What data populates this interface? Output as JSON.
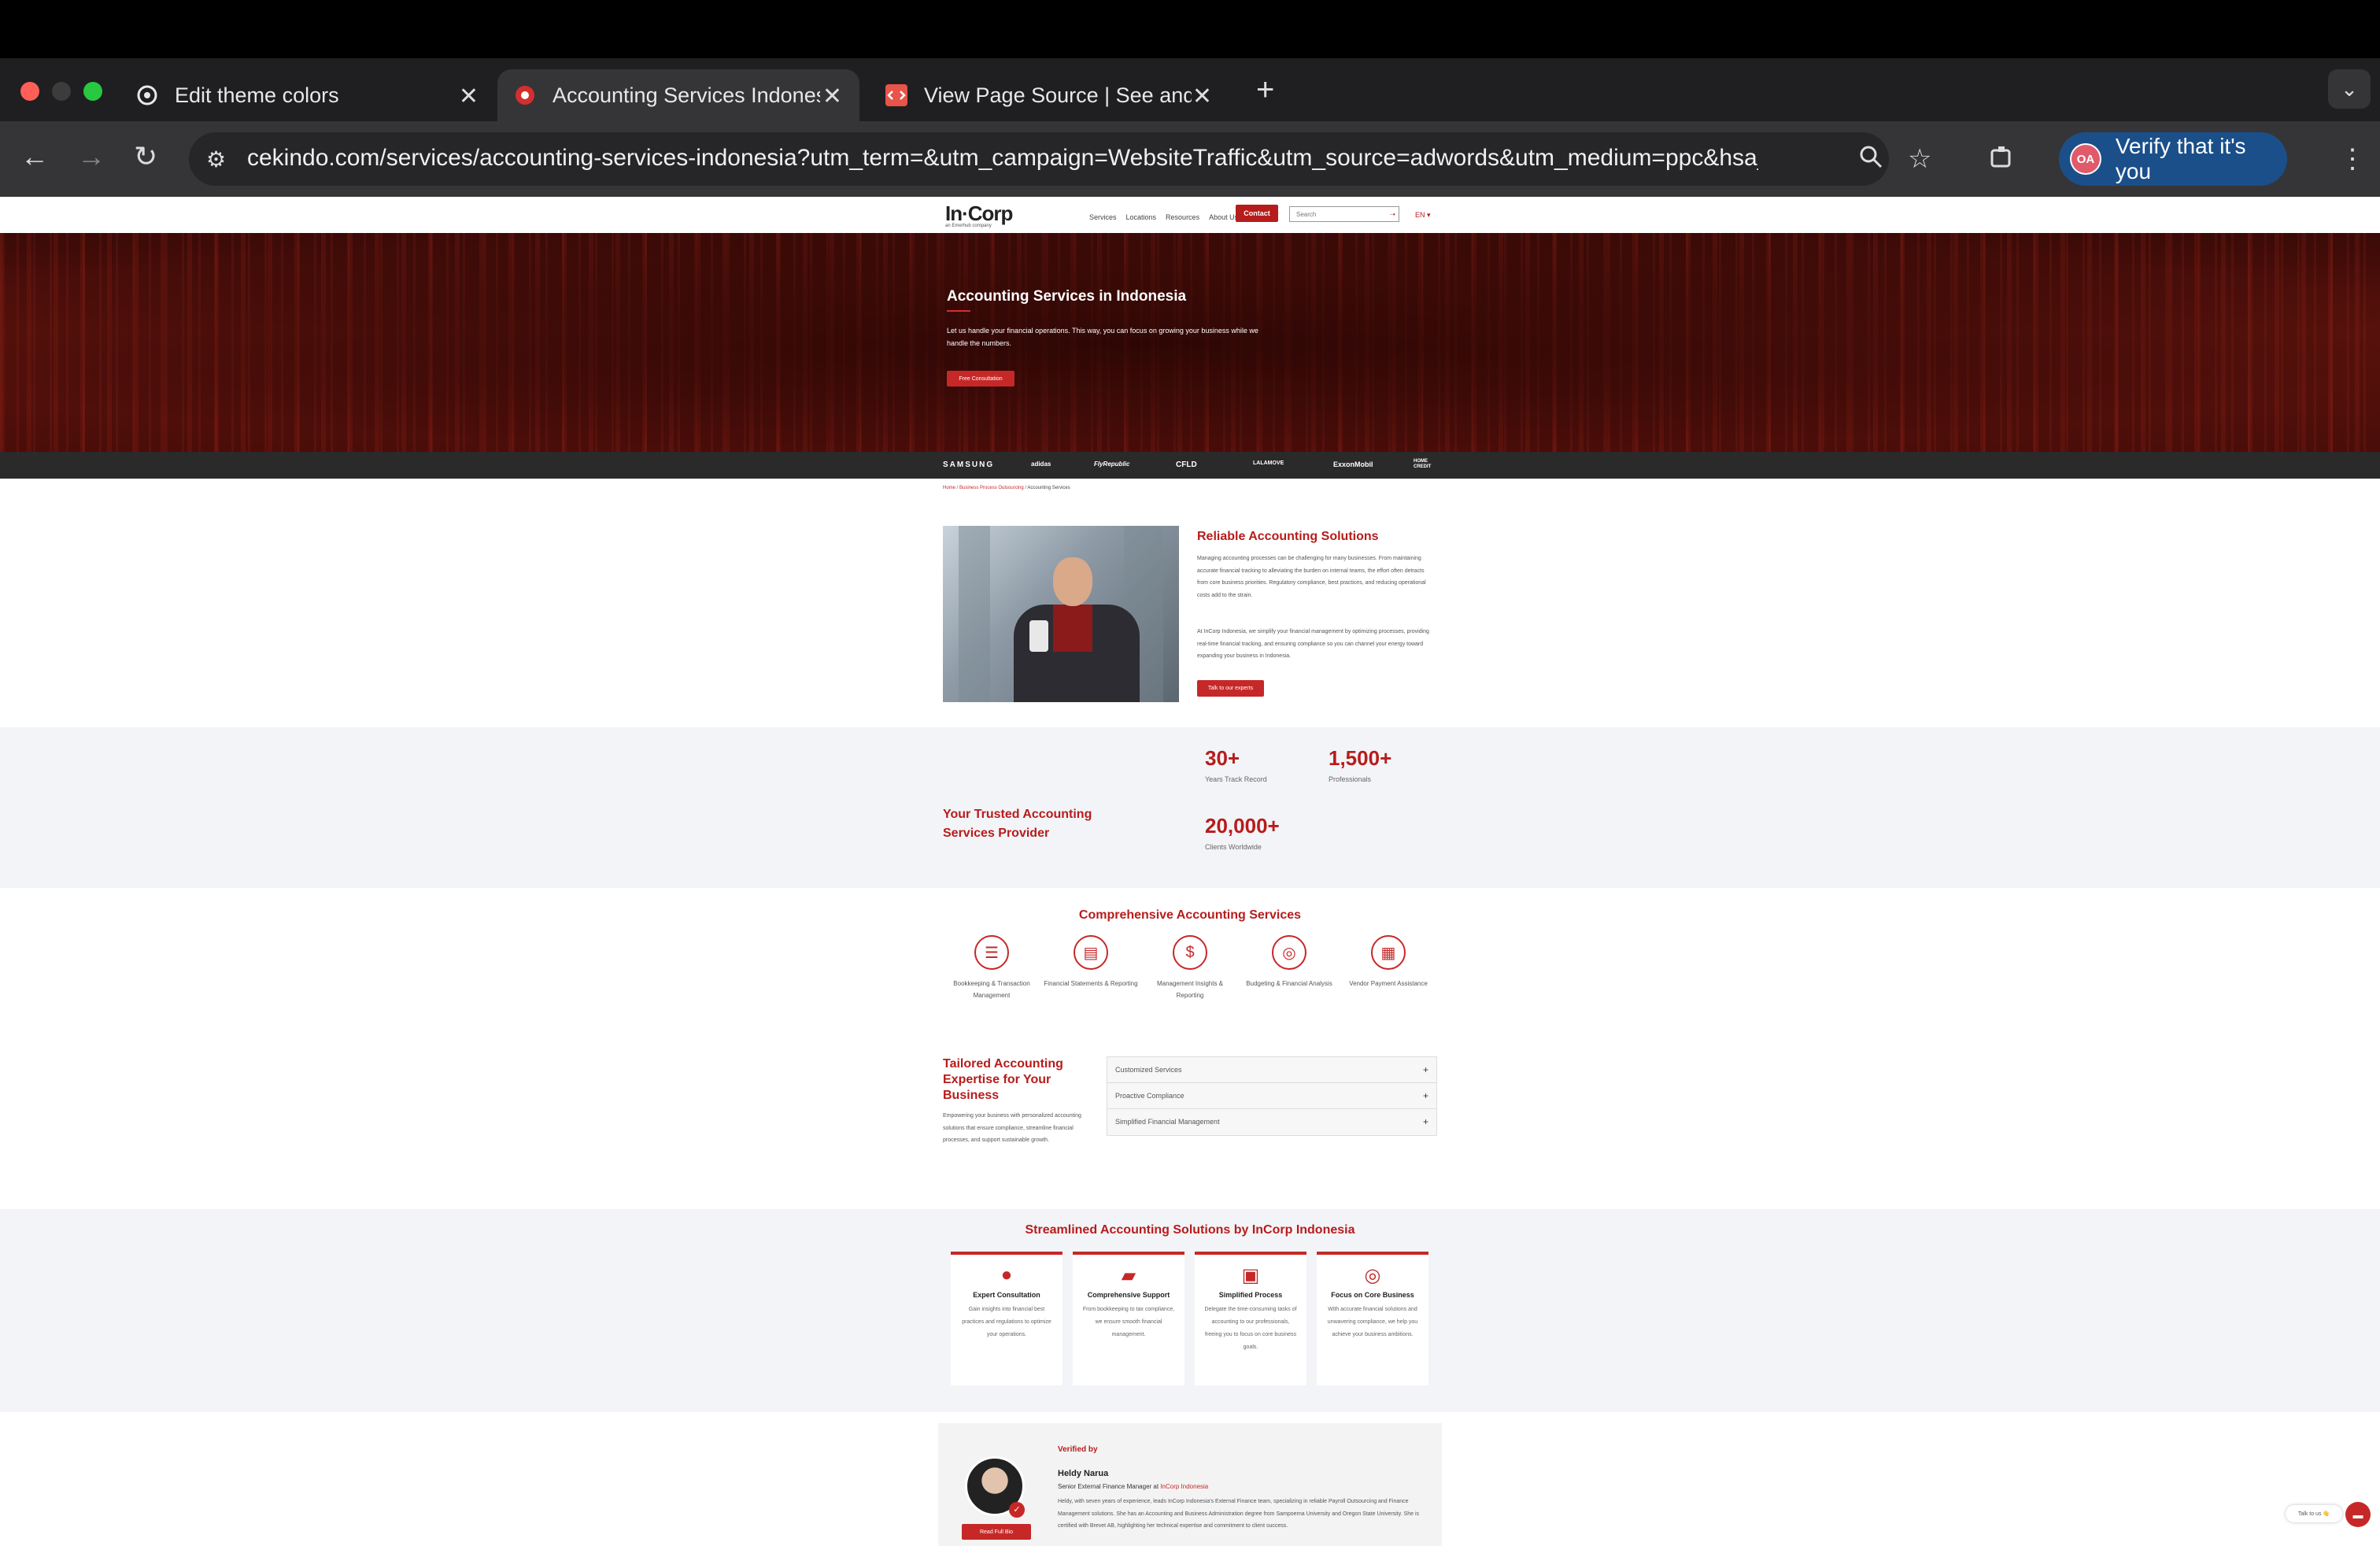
{
  "browser": {
    "tabs": [
      {
        "title": "Edit theme colors",
        "icon": "openai-icon"
      },
      {
        "title": "Accounting Services Indonesi",
        "icon": "incorp-icon"
      },
      {
        "title": "View Page Source | See and c",
        "icon": "code-icon"
      }
    ],
    "url": "cekindo.com/services/accounting-services-indonesia?utm_term=&utm_campaign=WebsiteTraffic&utm_source=adwords&utm_medium=ppc&hsa_acc=...",
    "profile_initials": "OA",
    "verify_label": "Verify that it's you"
  },
  "site": {
    "logo": "In·Corp",
    "logo_sub": "an Emerhub company",
    "nav": [
      "Services",
      "Locations",
      "Resources",
      "About Us"
    ],
    "contact_label": "Contact",
    "search_placeholder": "Search",
    "language": "EN ▾"
  },
  "hero": {
    "title": "Accounting Services in Indonesia",
    "text": "Let us handle your financial operations. This way, you can focus on growing your business while we handle the numbers.",
    "button": "Free Consultation"
  },
  "clients": [
    "SAMSUNG",
    "adidas",
    "FlyRepublic",
    "CFLD",
    "LALAMOVE",
    "ExxonMobil",
    "HOME CREDIT"
  ],
  "breadcrumb": {
    "home": "Home",
    "parent": "Business Process Outsourcing",
    "current": "Accounting Services"
  },
  "reliable": {
    "title": "Reliable Accounting Solutions",
    "p1": "Managing accounting processes can be challenging for many businesses. From maintaining accurate financial tracking to alleviating the burden on internal teams, the effort often detracts from core business priorities. Regulatory compliance, best practices, and reducing operational costs add to the strain.",
    "p2": "At InCorp Indonesia, we simplify your financial management by optimizing processes, providing real-time financial tracking, and ensuring compliance so you can channel your energy toward expanding your business in Indonesia.",
    "button": "Talk to our experts"
  },
  "trusted": {
    "title": "Your Trusted Accounting Services Provider",
    "stats": [
      {
        "value": "30+",
        "label": "Years Track Record"
      },
      {
        "value": "1,500+",
        "label": "Professionals"
      },
      {
        "value": "20,000+",
        "label": "Clients Worldwide"
      }
    ]
  },
  "comprehensive": {
    "title": "Comprehensive Accounting Services",
    "items": [
      "Bookkeeping & Transaction Management",
      "Financial Statements & Reporting",
      "Management Insights & Reporting",
      "Budgeting & Financial Analysis",
      "Vendor Payment Assistance"
    ]
  },
  "tailored": {
    "title": "Tailored Accounting Expertise for Your Business",
    "text": "Empowering your business with personalized accounting solutions that ensure compliance, streamline financial processes, and support sustainable growth.",
    "accordion": [
      "Customized Services",
      "Proactive Compliance",
      "Simplified Financial Management"
    ]
  },
  "streamlined": {
    "title": "Streamlined Accounting Solutions by InCorp Indonesia",
    "cards": [
      {
        "title": "Expert Consultation",
        "text": "Gain insights into financial best practices and regulations to optimize your operations."
      },
      {
        "title": "Comprehensive Support",
        "text": "From bookkeeping to tax compliance, we ensure smooth financial management."
      },
      {
        "title": "Simplified Process",
        "text": "Delegate the time-consuming tasks of accounting to our professionals, freeing you to focus on core business goals."
      },
      {
        "title": "Focus on Core Business",
        "text": "With accurate financial solutions and unwavering compliance, we help you achieve your business ambitions."
      }
    ]
  },
  "verified": {
    "label": "Verified by",
    "name": "Heldy Narua",
    "role": "Senior External Finance Manager",
    "at": " at ",
    "org": "InCorp Indonesia",
    "bio": "Heldy, with seven years of experience, leads InCorp Indonesia's External Finance team, specializing in reliable Payroll Outsourcing and Finance Management solutions. She has an Accounting and Business Administration degree from Sampoerna University and Oregon State University. She is certified with Brevet AB, highlighting her technical expertise and commitment to client success.",
    "button": "Read Full Bio"
  },
  "widget": {
    "talk": "Talk to us 👋"
  }
}
